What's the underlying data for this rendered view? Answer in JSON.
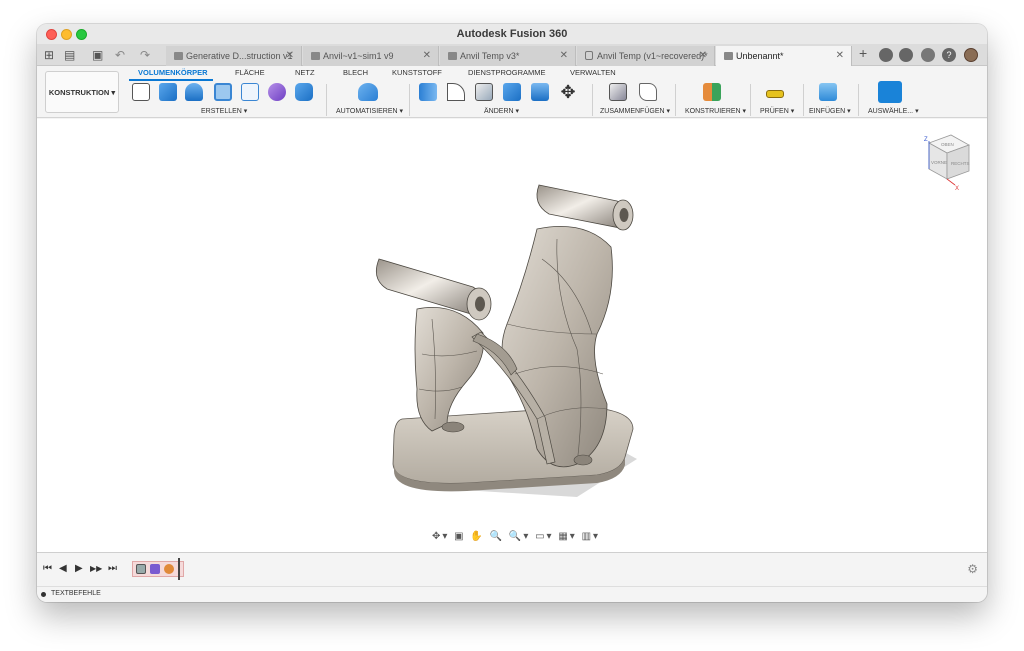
{
  "window": {
    "title": "Autodesk Fusion 360"
  },
  "doc_tabs": [
    {
      "label": "Generative D...struction v1"
    },
    {
      "label": "Anvil~v1~sim1 v9"
    },
    {
      "label": "Anvil Temp v3*"
    },
    {
      "label": "Anvil Temp (v1~recovered)*"
    },
    {
      "label": "Unbenannt*"
    }
  ],
  "tab_close": "✕",
  "toolbar_glyphs": {
    "grid": "⊞",
    "file": "▤",
    "save": "▣",
    "undo": "↶",
    "redo": "↷",
    "add_tab": "+",
    "help": "?"
  },
  "workspace": {
    "label": "KONSTRUKTION ▾"
  },
  "ribbon_tabs": [
    {
      "label": "VOLUMENKÖRPER"
    },
    {
      "label": "FLÄCHE"
    },
    {
      "label": "NETZ"
    },
    {
      "label": "BLECH"
    },
    {
      "label": "KUNSTSTOFF"
    },
    {
      "label": "DIENSTPROGRAMME"
    },
    {
      "label": "VERWALTEN"
    }
  ],
  "tool_groups": [
    {
      "label": "ERSTELLEN ▾"
    },
    {
      "label": "AUTOMATISIEREN ▾"
    },
    {
      "label": "ÄNDERN ▾"
    },
    {
      "label": "ZUSAMMENFÜGEN ▾"
    },
    {
      "label": "KONSTRUIEREN ▾"
    },
    {
      "label": "PRÜFEN ▾"
    },
    {
      "label": "EINFÜGEN ▾"
    },
    {
      "label": "AUSWÄHLE... ▾"
    }
  ],
  "viewcube": {
    "faces": {
      "top": "OBEN",
      "front": "VORNE",
      "right": "RECHTS"
    },
    "axes": {
      "z": "Z",
      "x": "X"
    }
  },
  "nav_bar": "✥▾ ▣ ✋ 🔍 🔍▾ ▭▾ ▦▾ ▥▾",
  "timeline": {
    "controls": [
      "⏮",
      "◀",
      "▶",
      "▶▶",
      "⏭"
    ],
    "settings": "⚙"
  },
  "status": {
    "label": "TEXTBEFEHLE"
  },
  "colors": {
    "accent": "#0a78d3",
    "model": "#c4bdb3",
    "background": "#ffffff"
  }
}
